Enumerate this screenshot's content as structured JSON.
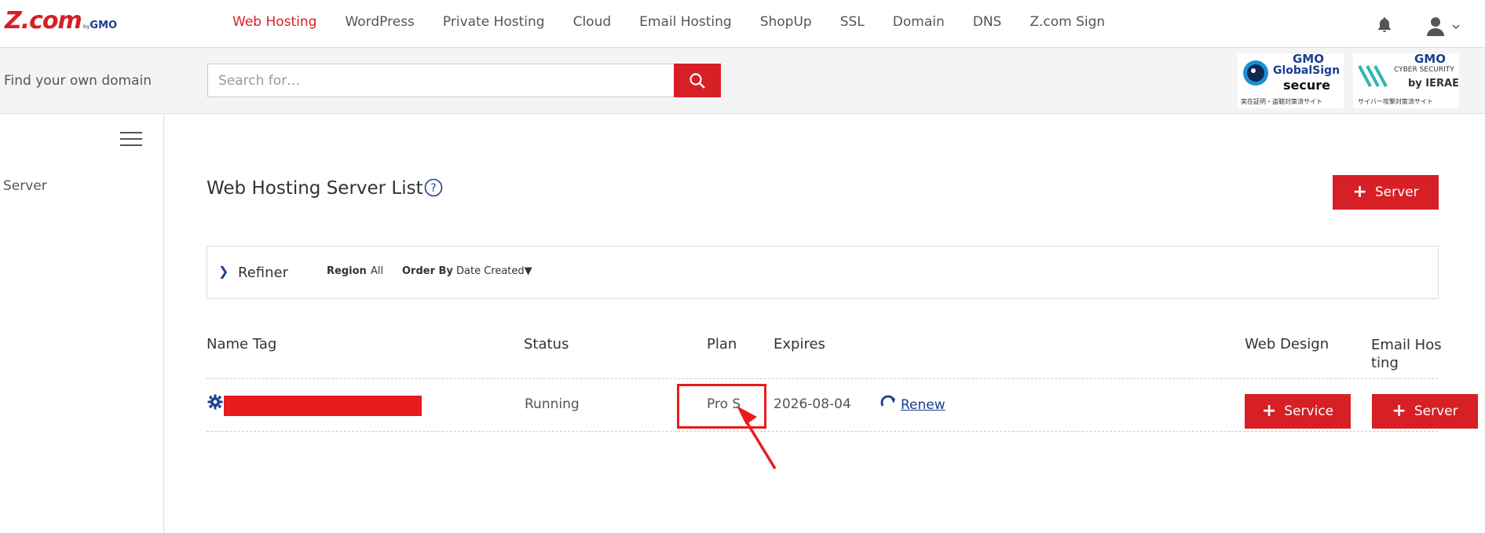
{
  "brand": {
    "logo_main": "Z.com",
    "logo_by": "by",
    "logo_gmo": "GMO"
  },
  "nav": {
    "items": [
      "Web Hosting",
      "WordPress",
      "Private Hosting",
      "Cloud",
      "Email Hosting",
      "ShopUp",
      "SSL",
      "Domain",
      "DNS",
      "Z.com Sign"
    ],
    "active": "Web Hosting"
  },
  "search": {
    "label": "Find your own domain",
    "placeholder": "Search for…"
  },
  "badges": {
    "globalsign": {
      "gmo": "GMO",
      "line1": "GlobalSign",
      "line2": "secure",
      "sub": "実在証明・盗聴対策済サイト"
    },
    "ierae": {
      "gmo": "GMO",
      "line1": "CYBER SECURITY",
      "line2": "by IERAE",
      "sub": "サイバー攻撃対策済サイト"
    }
  },
  "sidebar": {
    "items": [
      {
        "label": "Server"
      }
    ]
  },
  "main": {
    "title": "Web Hosting Server List",
    "add_server_label": "Server",
    "refiner": {
      "label": "Refiner",
      "region_label": "Region",
      "region_value": "All",
      "order_label": "Order By",
      "order_value": "Date Created▼"
    },
    "table": {
      "headers": {
        "name_tag": "Name Tag",
        "status": "Status",
        "plan": "Plan",
        "expires": "Expires",
        "web_design": "Web Design",
        "email_hosting_line1": "Email Hos",
        "email_hosting_line2": "ting"
      },
      "rows": [
        {
          "status": "Running",
          "plan": "Pro S",
          "expires": "2026-08-04",
          "renew_label": "Renew",
          "web_design_button": "Service",
          "email_button": "Server"
        }
      ]
    }
  },
  "colors": {
    "accent": "#d71f26",
    "link": "#1b3f8f",
    "annotation": "#e81c1c"
  }
}
